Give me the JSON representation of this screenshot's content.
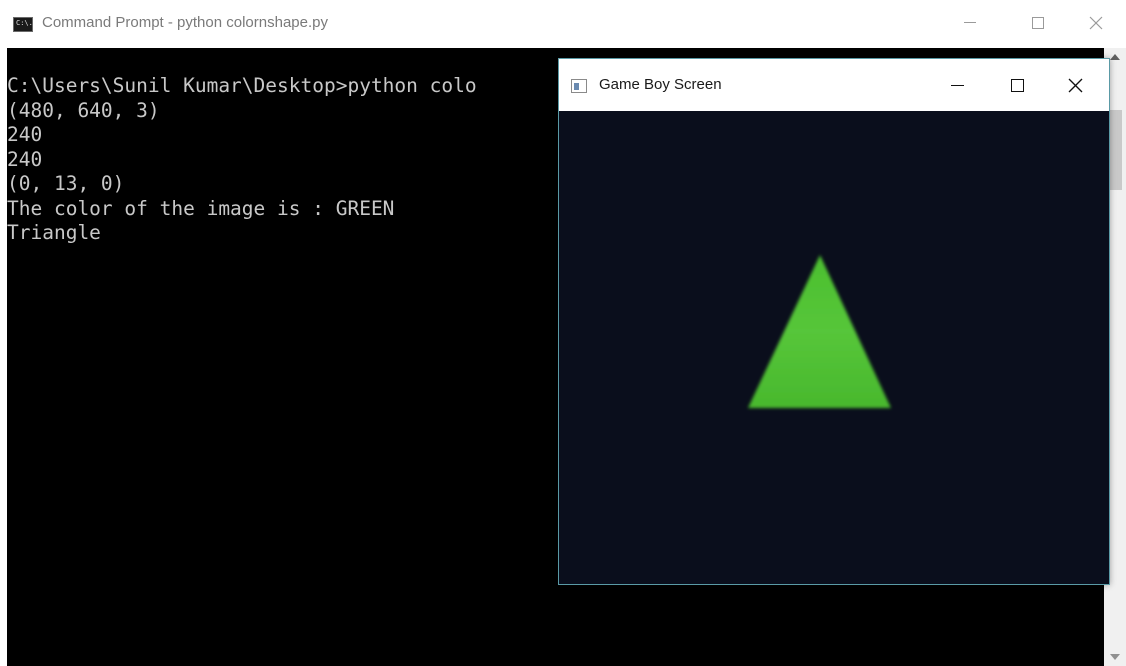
{
  "cmd_window": {
    "title": "Command Prompt - python  colornshape.py",
    "icon": "cmd-icon",
    "icon_text": "C:\\."
  },
  "console": {
    "lines": [
      "C:\\Users\\Sunil Kumar\\Desktop>python colo",
      "(480, 640, 3)",
      "240",
      "240",
      "(0, 13, 0)",
      "The color of the image is : GREEN",
      "Triangle"
    ]
  },
  "gameboy_window": {
    "title": "Game Boy Screen",
    "icon": "window-icon",
    "shape": "triangle",
    "shape_color": "#4fc233",
    "background_color": "#0a0e1c"
  },
  "colors": {
    "console_bg": "#000000",
    "console_text": "#c8c8c8",
    "window_border": "#5a9aa6"
  }
}
